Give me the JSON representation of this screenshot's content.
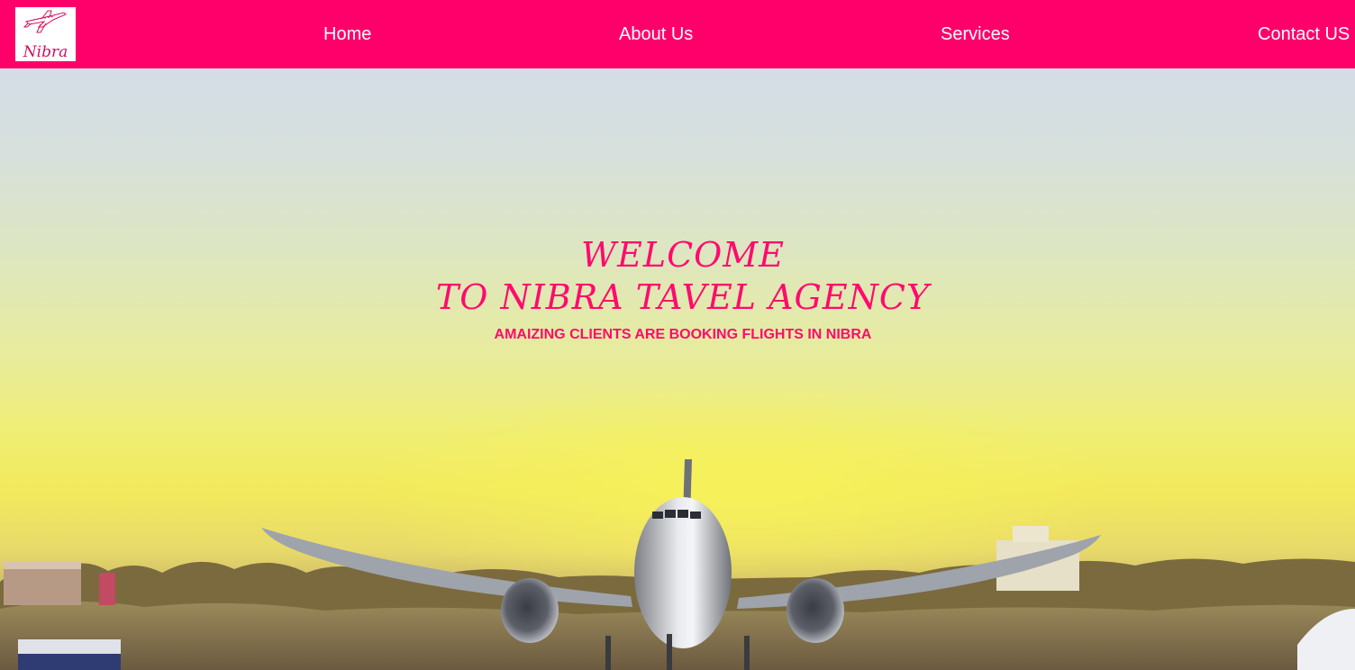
{
  "brand": {
    "logo_text": "Nibra",
    "logo_icon": "airplane-icon"
  },
  "nav": {
    "home": "Home",
    "about": "About Us",
    "services": "Services",
    "contact": "Contact US"
  },
  "hero": {
    "title_line1": "WELCOME",
    "title_line2": "TO NIBRA TAVEL AGENCY",
    "subtitle": "AMAIZING CLIENTS ARE BOOKING FLIGHTS IN NIBRA"
  },
  "colors": {
    "primary": "#ff006b",
    "heading": "#ff0a6e",
    "nav_text": "#ffffff"
  }
}
